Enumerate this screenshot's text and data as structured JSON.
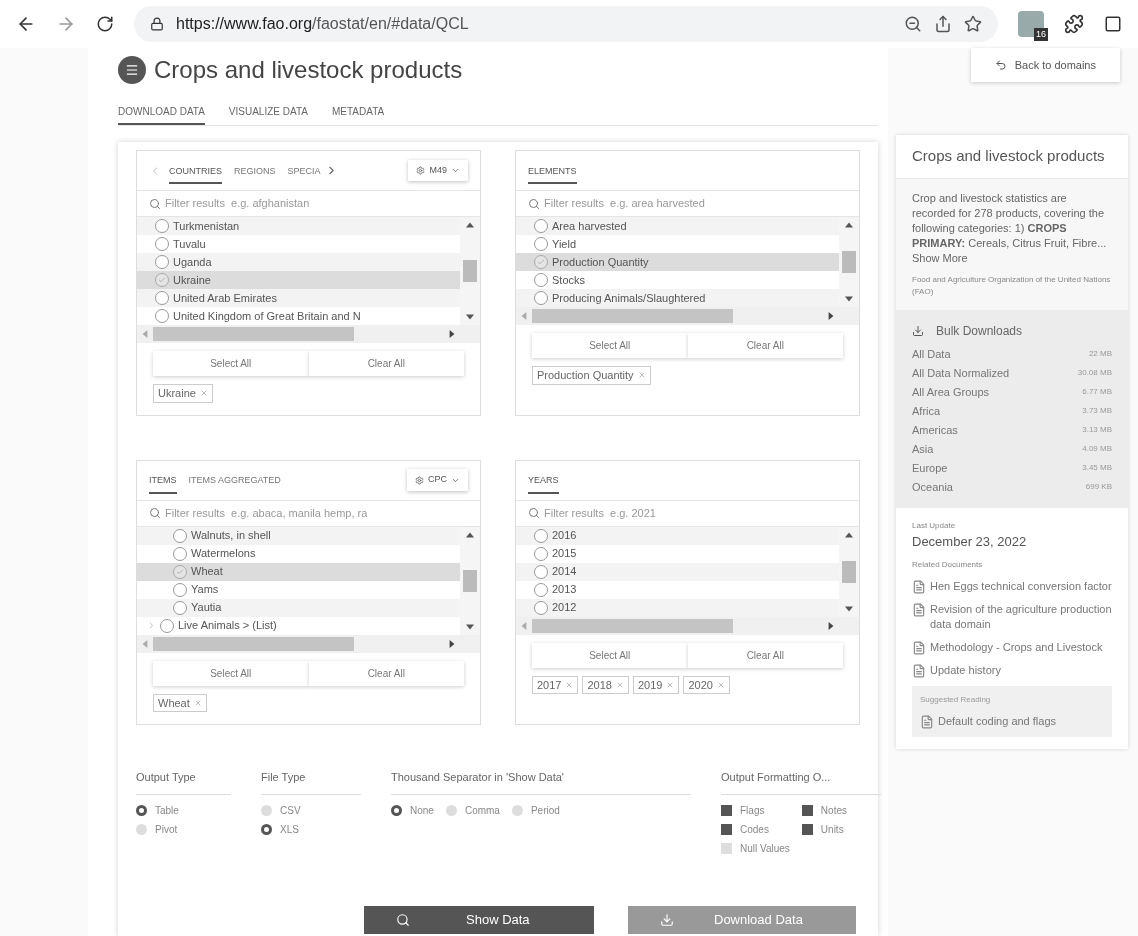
{
  "browser": {
    "url_host": "https://www.fao.org",
    "url_path": "/faostat/en/#data/QCL",
    "extension_badge": "16"
  },
  "header": {
    "title": "Crops and livestock products",
    "back_button": "Back to domains"
  },
  "page_tabs": [
    {
      "label": "DOWNLOAD DATA",
      "selected": true
    },
    {
      "label": "VISUALIZE DATA",
      "selected": false
    },
    {
      "label": "METADATA",
      "selected": false
    }
  ],
  "panels": [
    {
      "tabs": [
        {
          "label": "COUNTRIES",
          "selected": true
        },
        {
          "label": "REGIONS",
          "selected": false
        },
        {
          "label": "SPECIA",
          "selected": false
        }
      ],
      "scroll_tabs": true,
      "code_button": "M49",
      "placeholder": "Filter results  e.g. afghanistan",
      "rows": [
        {
          "label": "Turkmenistan",
          "selected": false,
          "kind": "leaf"
        },
        {
          "label": "Tuvalu",
          "selected": false,
          "kind": "leaf"
        },
        {
          "label": "Uganda",
          "selected": false,
          "kind": "leaf"
        },
        {
          "label": "Ukraine",
          "selected": true,
          "kind": "leaf"
        },
        {
          "label": "United Arab Emirates",
          "selected": false,
          "kind": "leaf"
        },
        {
          "label": "United Kingdom of Great Britain and N",
          "selected": false,
          "kind": "leaf"
        }
      ],
      "select_all": "Select All",
      "clear_all": "Clear All",
      "chips": [
        "Ukraine"
      ]
    },
    {
      "tabs": [
        {
          "label": "ELEMENTS",
          "selected": true
        }
      ],
      "scroll_tabs": false,
      "placeholder": "Filter results  e.g. area harvested",
      "rows": [
        {
          "label": "Area harvested",
          "selected": false,
          "kind": "leaf"
        },
        {
          "label": "Yield",
          "selected": false,
          "kind": "leaf"
        },
        {
          "label": "Production Quantity",
          "selected": true,
          "kind": "leaf"
        },
        {
          "label": "Stocks",
          "selected": false,
          "kind": "leaf"
        },
        {
          "label": "Producing Animals/Slaughtered",
          "selected": false,
          "kind": "leaf"
        }
      ],
      "select_all": "Select All",
      "clear_all": "Clear All",
      "chips": [
        "Production Quantity"
      ]
    },
    {
      "tabs": [
        {
          "label": "ITEMS",
          "selected": true
        },
        {
          "label": "ITEMS AGGREGATED",
          "selected": false
        }
      ],
      "scroll_tabs": false,
      "code_button": "CPC",
      "placeholder": "Filter results  e.g. abaca, manila hemp, ra",
      "rows": [
        {
          "label": "Walnuts, in shell",
          "selected": false,
          "kind": "child"
        },
        {
          "label": "Watermelons",
          "selected": false,
          "kind": "child"
        },
        {
          "label": "Wheat",
          "selected": true,
          "kind": "child"
        },
        {
          "label": "Yams",
          "selected": false,
          "kind": "child"
        },
        {
          "label": "Yautia",
          "selected": false,
          "kind": "child"
        },
        {
          "label": "Live Animals > (List)",
          "selected": false,
          "kind": "group"
        }
      ],
      "select_all": "Select All",
      "clear_all": "Clear All",
      "chips": [
        "Wheat"
      ]
    },
    {
      "tabs": [
        {
          "label": "YEARS",
          "selected": true
        }
      ],
      "scroll_tabs": false,
      "placeholder": "Filter results  e.g. 2021",
      "rows": [
        {
          "label": "2016",
          "selected": false,
          "kind": "leaf"
        },
        {
          "label": "2015",
          "selected": false,
          "kind": "leaf"
        },
        {
          "label": "2014",
          "selected": false,
          "kind": "leaf"
        },
        {
          "label": "2013",
          "selected": false,
          "kind": "leaf"
        },
        {
          "label": "2012",
          "selected": false,
          "kind": "leaf"
        }
      ],
      "select_all": "Select All",
      "clear_all": "Clear All",
      "chips": [
        "2017",
        "2018",
        "2019",
        "2020"
      ]
    }
  ],
  "options": [
    {
      "title": "Output Type",
      "kind": "radio",
      "choices": [
        {
          "label": "Table",
          "selected": true
        },
        {
          "label": "Pivot",
          "selected": false
        }
      ]
    },
    {
      "title": "File Type",
      "kind": "radio",
      "choices": [
        {
          "label": "CSV",
          "selected": false
        },
        {
          "label": "XLS",
          "selected": true
        }
      ]
    },
    {
      "title": "Thousand Separator in 'Show Data'",
      "kind": "radio_row",
      "choices": [
        {
          "label": "None",
          "selected": true
        },
        {
          "label": "Comma",
          "selected": false
        },
        {
          "label": "Period",
          "selected": false
        }
      ]
    },
    {
      "title": "Output Formatting O...",
      "kind": "checkbox",
      "choices": [
        {
          "label": "Flags",
          "selected": true
        },
        {
          "label": "Notes",
          "selected": true
        },
        {
          "label": "Codes",
          "selected": true
        },
        {
          "label": "Units",
          "selected": true
        },
        {
          "label": "Null Values",
          "selected": false
        }
      ]
    }
  ],
  "actions": {
    "show": "Show Data",
    "download": "Download Data"
  },
  "sidebar": {
    "title": "Crops and livestock products",
    "description": "Crop and livestock statistics are recorded for 278 products, covering the following categories: 1) **CROPS PRIMARY:** Cereals, Citrus Fruit, Fibre... Show More",
    "source": "Food and Agriculture Organization of the United Nations (FAO)",
    "bulk_title": "Bulk Downloads",
    "bulk": [
      {
        "label": "All Data",
        "size": "22 MB"
      },
      {
        "label": "All Data Normalized",
        "size": "30.08 MB"
      },
      {
        "label": "All Area Groups",
        "size": "6.77 MB"
      },
      {
        "label": "Africa",
        "size": "3.73 MB"
      },
      {
        "label": "Americas",
        "size": "3.13 MB"
      },
      {
        "label": "Asia",
        "size": "4.09 MB"
      },
      {
        "label": "Europe",
        "size": "3.45 MB"
      },
      {
        "label": "Oceania",
        "size": "699 KB"
      }
    ],
    "last_update_label": "Last Update",
    "last_update": "December 23, 2022",
    "related_label": "Related Documents",
    "related": [
      "Hen Eggs technical conversion factor",
      "Revision of the agriculture production data domain",
      "Methodology - Crops and Livestock",
      "Update history"
    ],
    "suggested_label": "Suggested Reading",
    "suggested": [
      "Default coding and flags"
    ]
  }
}
